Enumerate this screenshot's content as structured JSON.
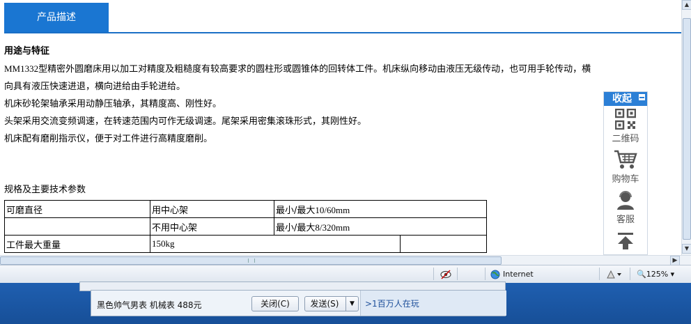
{
  "tab": {
    "label": "产品描述"
  },
  "features": {
    "title": "用途与特征",
    "model": "MM1332",
    "line1_rest": "型精密外圆磨床用以加工对精度及粗糙度有较高要求的圆柱形或圆锥体的回转体工件。机床纵向移动由液压无级传动，也可用手轮传动，横",
    "line2": "向具有液压快速进退，横向进给由手轮进给。",
    "line3": "机床砂轮架轴承采用动静压轴承，其精度高、刚性好。",
    "line4": "头架采用交流变频调速，在转速范围内可作无级调速。尾架采用密集滚珠形式，其刚性好。",
    "line5": "机床配有磨削指示仪，便于对工件进行高精度磨削。"
  },
  "specs": {
    "title": "规格及主要技术参数",
    "rows": [
      {
        "c1": "可磨直径",
        "c2": "用中心架",
        "c3_text": "最小/最大",
        "c3_val": "10/60mm"
      },
      {
        "c1": "",
        "c2": "不用中心架",
        "c3_text": "最小/最大",
        "c3_val": "8/320mm"
      },
      {
        "c1": "工件最大重量",
        "c2": "150kg"
      }
    ]
  },
  "side_widget": {
    "collapse_label": "收起",
    "items": [
      {
        "label": "二维码",
        "icon": "qr-code-icon"
      },
      {
        "label": "购物车",
        "icon": "shopping-cart-icon"
      },
      {
        "label": "客服",
        "icon": "customer-service-icon"
      },
      {
        "label": "",
        "icon": "back-to-top-icon"
      }
    ]
  },
  "status_bar": {
    "zone": "Internet",
    "zoom": "125%"
  },
  "popup": {
    "message": "黑色帅气男表 机械表 488元",
    "close_label": "关闭(C)",
    "send_label": "发送(S)",
    "link_text": ">1百万人在玩"
  },
  "colors": {
    "accent": "#1a76d2",
    "side_header": "#2b7fd6",
    "taskbar": "#1f5fb0"
  }
}
